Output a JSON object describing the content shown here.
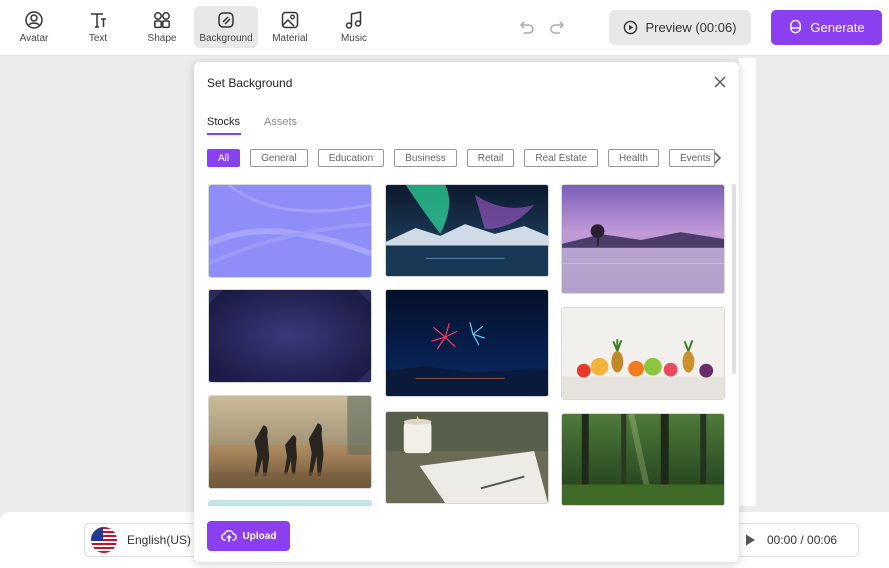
{
  "toolbar": {
    "tools": [
      {
        "label": "Avatar",
        "icon": "avatar-icon"
      },
      {
        "label": "Text",
        "icon": "text-icon"
      },
      {
        "label": "Shape",
        "icon": "shape-icon"
      },
      {
        "label": "Background",
        "icon": "background-icon"
      },
      {
        "label": "Material",
        "icon": "material-icon"
      },
      {
        "label": "Music",
        "icon": "music-icon"
      }
    ],
    "active_tool": "Background",
    "preview_label": "Preview (00:06)",
    "generate_label": "Generate"
  },
  "dialog": {
    "title": "Set Background",
    "tabs": [
      "Stocks",
      "Assets"
    ],
    "active_tab": "Stocks",
    "categories": [
      "All",
      "General",
      "Education",
      "Business",
      "Retail",
      "Real Estate",
      "Health",
      "Events"
    ],
    "active_category": "All",
    "thumbnails": [
      "purple-gradient",
      "northern-lights",
      "purple-lake-tree",
      "dark-blue-vignette",
      "fireworks-night",
      "fruits-arrangement",
      "basketball-players",
      "candle-notebook",
      "green-forest"
    ],
    "upload_label": "Upload"
  },
  "bottom": {
    "language": "English(US) -",
    "time": "00:00 / 00:06"
  },
  "colors": {
    "accent": "#8a3ff0",
    "toolbar_active_bg": "#e8e8e8"
  }
}
